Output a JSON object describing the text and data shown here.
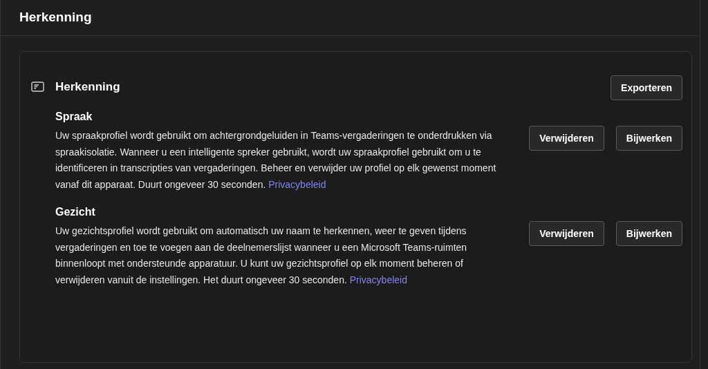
{
  "page_title": "Herkenning",
  "card": {
    "title": "Herkenning",
    "export_button": "Exporteren",
    "sections": [
      {
        "title": "Spraak",
        "text": "Uw spraakprofiel wordt gebruikt om achtergrondgeluiden in Teams-vergaderingen te onderdrukken via spraakisolatie. Wanneer u een intelligente spreker gebruikt, wordt uw spraakprofiel gebruikt om u te identificeren in transcripties van vergaderingen. Beheer en verwijder uw profiel op elk gewenst moment vanaf dit apparaat. Duurt ongeveer 30 seconden.",
        "link": "Privacybeleid",
        "buttons": [
          "Verwijderen",
          "Bijwerken"
        ]
      },
      {
        "title": "Gezicht",
        "text": "Uw gezichtsprofiel wordt gebruikt om automatisch uw naam te herkennen, weer te geven tijdens vergaderingen en toe te voegen aan de deelnemerslijst wanneer u een Microsoft Teams-ruimten binnenloopt met ondersteunde apparatuur. U kunt uw gezichtsprofiel op elk moment beheren of verwijderen vanuit de instellingen. Het duurt ongeveer 30 seconden.",
        "link": "Privacybeleid",
        "buttons": [
          "Verwijderen",
          "Bijwerken"
        ]
      }
    ]
  }
}
